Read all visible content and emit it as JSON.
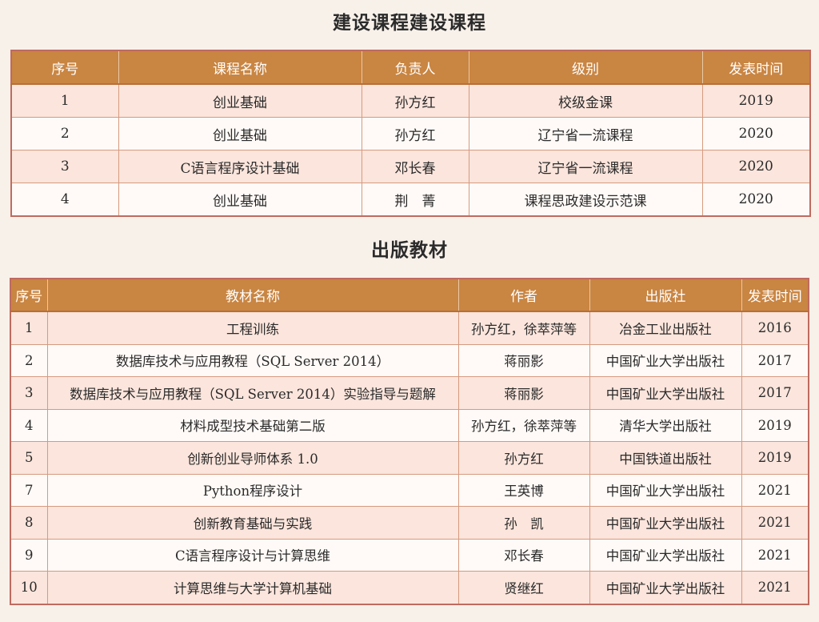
{
  "section1": {
    "title": "建设课程建设课程",
    "headers": [
      "序号",
      "课程名称",
      "负责人",
      "级别",
      "发表时间"
    ],
    "rows": [
      [
        "1",
        "创业基础",
        "孙方红",
        "校级金课",
        "2019"
      ],
      [
        "2",
        "创业基础",
        "孙方红",
        "辽宁省一流课程",
        "2020"
      ],
      [
        "3",
        "C语言程序设计基础",
        "邓长春",
        "辽宁省一流课程",
        "2020"
      ],
      [
        "4",
        "创业基础",
        "荆　菁",
        "课程思政建设示范课",
        "2020"
      ]
    ]
  },
  "section2": {
    "title": "出版教材",
    "headers": [
      "序号",
      "教材名称",
      "作者",
      "出版社",
      "发表时间"
    ],
    "rows": [
      [
        "1",
        "工程训练",
        "孙方红，徐萃萍等",
        "冶金工业出版社",
        "2016"
      ],
      [
        "2",
        "数据库技术与应用教程（SQL Server 2014）",
        "蒋丽影",
        "中国矿业大学出版社",
        "2017"
      ],
      [
        "3",
        "数据库技术与应用教程（SQL Server 2014）实验指导与题解",
        "蒋丽影",
        "中国矿业大学出版社",
        "2017"
      ],
      [
        "4",
        "材料成型技术基础第二版",
        "孙方红，徐萃萍等",
        "清华大学出版社",
        "2019"
      ],
      [
        "5",
        "创新创业导师体系 1.0",
        "孙方红",
        "中国铁道出版社",
        "2019"
      ],
      [
        "7",
        "Python程序设计",
        "王英博",
        "中国矿业大学出版社",
        "2021"
      ],
      [
        "8",
        "创新教育基础与实践",
        "孙　凯",
        "中国矿业大学出版社",
        "2021"
      ],
      [
        "9",
        "C语言程序设计与计算思维",
        "邓长春",
        "中国矿业大学出版社",
        "2021"
      ],
      [
        "10",
        "计算思维与大学计算机基础",
        "贤继红",
        "中国矿业大学出版社",
        "2021"
      ]
    ]
  }
}
